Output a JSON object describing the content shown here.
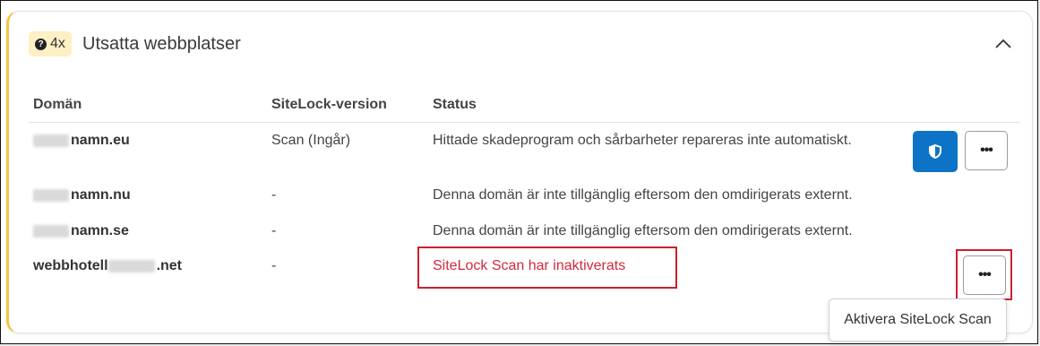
{
  "card": {
    "badge_count": "4x",
    "title": "Utsatta webbplatser"
  },
  "table": {
    "columns": [
      "Domän",
      "SiteLock-version",
      "Status"
    ],
    "rows": [
      {
        "domain": "namn.eu",
        "version": "Scan (Ingår)",
        "status": "Hittade skadeprogram och sårbarheter repareras inte automatiskt."
      },
      {
        "domain": "namn.nu",
        "version": "-",
        "status": "Denna domän är inte tillgänglig eftersom den omdirigerats externt."
      },
      {
        "domain": "namn.se",
        "version": "-",
        "status": "Denna domän är inte tillgänglig eftersom den omdirigerats externt."
      },
      {
        "domain_prefix": "webbhotell",
        "domain": ".net",
        "version": "-",
        "status": "SiteLock Scan har inaktiverats"
      }
    ]
  },
  "actions": {
    "more_label": "•••",
    "dropdown_item": "Aktivera SiteLock Scan"
  },
  "colors": {
    "accent": "#0d73c6",
    "warning_border": "#f5c542",
    "badge_bg": "#fdf0c4",
    "error_text": "#d12a3a",
    "highlight": "#cc1f2b"
  },
  "icons": {
    "badge": "question-circle-icon",
    "collapse": "chevron-up-icon",
    "shield": "shield-icon",
    "more": "more-horizontal-icon"
  }
}
